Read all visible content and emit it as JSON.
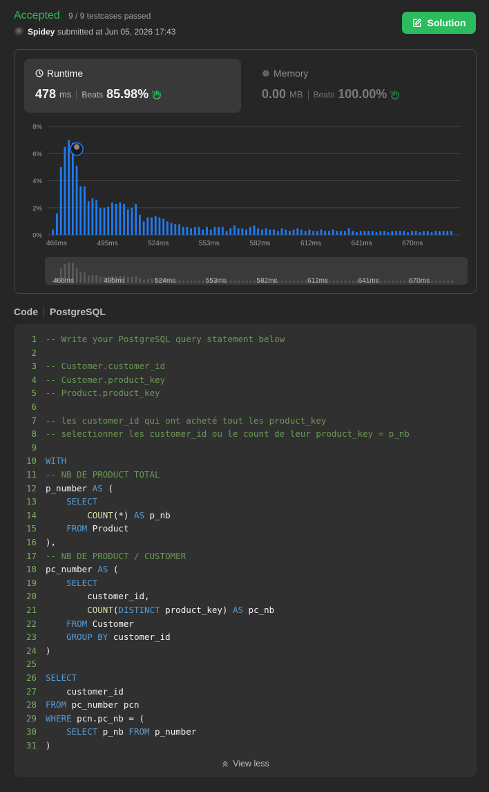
{
  "header": {
    "status": "Accepted",
    "testcases": "9 / 9 testcases passed",
    "username": "Spidey",
    "submitted": "submitted at Jun 05, 2026 17:43",
    "solution_label": "Solution"
  },
  "runtime": {
    "title": "Runtime",
    "value": "478",
    "unit": "ms",
    "beats_label": "Beats",
    "beats": "85.98%"
  },
  "memory": {
    "title": "Memory",
    "value": "0.00",
    "unit": "MB",
    "beats_label": "Beats",
    "beats": "100.00%"
  },
  "colors": {
    "accent": "#2cbb5d",
    "bar": "#1f7bf2",
    "gold_hand": "#2cbb5d"
  },
  "chart_data": {
    "type": "bar",
    "ylabel": "",
    "xlabel": "",
    "y_ticks": [
      "8%",
      "6%",
      "4%",
      "2%",
      "0%"
    ],
    "ylim": [
      0,
      8
    ],
    "x_tick_labels": [
      "466ms",
      "495ms",
      "524ms",
      "553ms",
      "582ms",
      "612ms",
      "641ms",
      "670ms"
    ],
    "xlim": [
      461,
      691
    ],
    "highlight_x": 478,
    "values": [
      {
        "x": 464,
        "y": 0.4
      },
      {
        "x": 466.2,
        "y": 1.6
      },
      {
        "x": 468.4,
        "y": 5.0
      },
      {
        "x": 470.6,
        "y": 6.5
      },
      {
        "x": 472.8,
        "y": 7.0
      },
      {
        "x": 475,
        "y": 6.8
      },
      {
        "x": 477.2,
        "y": 5.1
      },
      {
        "x": 479.4,
        "y": 3.6
      },
      {
        "x": 481.6,
        "y": 3.6
      },
      {
        "x": 483.8,
        "y": 2.5
      },
      {
        "x": 486,
        "y": 2.7
      },
      {
        "x": 488.2,
        "y": 2.6
      },
      {
        "x": 490.4,
        "y": 2.0
      },
      {
        "x": 492.6,
        "y": 2.0
      },
      {
        "x": 494.8,
        "y": 2.1
      },
      {
        "x": 497,
        "y": 2.4
      },
      {
        "x": 499.2,
        "y": 2.3
      },
      {
        "x": 501.4,
        "y": 2.4
      },
      {
        "x": 503.6,
        "y": 2.3
      },
      {
        "x": 505.8,
        "y": 1.9
      },
      {
        "x": 508,
        "y": 2.0
      },
      {
        "x": 510.2,
        "y": 2.3
      },
      {
        "x": 512.4,
        "y": 1.5
      },
      {
        "x": 514.6,
        "y": 1.0
      },
      {
        "x": 516.8,
        "y": 1.3
      },
      {
        "x": 519,
        "y": 1.3
      },
      {
        "x": 521.2,
        "y": 1.4
      },
      {
        "x": 523.4,
        "y": 1.3
      },
      {
        "x": 525.6,
        "y": 1.2
      },
      {
        "x": 527.8,
        "y": 1.0
      },
      {
        "x": 530,
        "y": 0.9
      },
      {
        "x": 532.2,
        "y": 0.8
      },
      {
        "x": 534.4,
        "y": 0.8
      },
      {
        "x": 536.6,
        "y": 0.6
      },
      {
        "x": 538.8,
        "y": 0.6
      },
      {
        "x": 541,
        "y": 0.5
      },
      {
        "x": 543.2,
        "y": 0.6
      },
      {
        "x": 545.4,
        "y": 0.6
      },
      {
        "x": 547.6,
        "y": 0.4
      },
      {
        "x": 549.8,
        "y": 0.6
      },
      {
        "x": 552,
        "y": 0.4
      },
      {
        "x": 554.2,
        "y": 0.6
      },
      {
        "x": 556.4,
        "y": 0.6
      },
      {
        "x": 558.6,
        "y": 0.6
      },
      {
        "x": 560.8,
        "y": 0.3
      },
      {
        "x": 563,
        "y": 0.5
      },
      {
        "x": 565.2,
        "y": 0.7
      },
      {
        "x": 567.4,
        "y": 0.5
      },
      {
        "x": 569.6,
        "y": 0.5
      },
      {
        "x": 571.8,
        "y": 0.4
      },
      {
        "x": 574,
        "y": 0.6
      },
      {
        "x": 576.2,
        "y": 0.7
      },
      {
        "x": 578.4,
        "y": 0.5
      },
      {
        "x": 580.6,
        "y": 0.4
      },
      {
        "x": 582.8,
        "y": 0.5
      },
      {
        "x": 585,
        "y": 0.4
      },
      {
        "x": 587.2,
        "y": 0.4
      },
      {
        "x": 589.4,
        "y": 0.3
      },
      {
        "x": 591.6,
        "y": 0.5
      },
      {
        "x": 593.8,
        "y": 0.4
      },
      {
        "x": 596,
        "y": 0.3
      },
      {
        "x": 598.2,
        "y": 0.4
      },
      {
        "x": 600.4,
        "y": 0.5
      },
      {
        "x": 602.6,
        "y": 0.4
      },
      {
        "x": 604.8,
        "y": 0.3
      },
      {
        "x": 607,
        "y": 0.4
      },
      {
        "x": 609.2,
        "y": 0.3
      },
      {
        "x": 611.4,
        "y": 0.3
      },
      {
        "x": 613.6,
        "y": 0.4
      },
      {
        "x": 615.8,
        "y": 0.3
      },
      {
        "x": 618,
        "y": 0.3
      },
      {
        "x": 620.2,
        "y": 0.4
      },
      {
        "x": 622.4,
        "y": 0.3
      },
      {
        "x": 624.6,
        "y": 0.3
      },
      {
        "x": 626.8,
        "y": 0.3
      },
      {
        "x": 629,
        "y": 0.5
      },
      {
        "x": 631.2,
        "y": 0.3
      },
      {
        "x": 633.4,
        "y": 0.2
      },
      {
        "x": 635.6,
        "y": 0.3
      },
      {
        "x": 637.8,
        "y": 0.3
      },
      {
        "x": 640,
        "y": 0.3
      },
      {
        "x": 642.2,
        "y": 0.3
      },
      {
        "x": 644.4,
        "y": 0.2
      },
      {
        "x": 646.6,
        "y": 0.3
      },
      {
        "x": 648.8,
        "y": 0.3
      },
      {
        "x": 651,
        "y": 0.2
      },
      {
        "x": 653.2,
        "y": 0.3
      },
      {
        "x": 655.4,
        "y": 0.3
      },
      {
        "x": 657.6,
        "y": 0.3
      },
      {
        "x": 659.8,
        "y": 0.3
      },
      {
        "x": 662,
        "y": 0.2
      },
      {
        "x": 664.2,
        "y": 0.3
      },
      {
        "x": 666.4,
        "y": 0.3
      },
      {
        "x": 668.6,
        "y": 0.2
      },
      {
        "x": 670.8,
        "y": 0.3
      },
      {
        "x": 673,
        "y": 0.3
      },
      {
        "x": 675.2,
        "y": 0.2
      },
      {
        "x": 677.4,
        "y": 0.3
      },
      {
        "x": 679.6,
        "y": 0.3
      },
      {
        "x": 681.8,
        "y": 0.3
      },
      {
        "x": 684,
        "y": 0.3
      },
      {
        "x": 686.2,
        "y": 0.3
      }
    ],
    "navigator_tick_labels": [
      "466ms",
      "495ms",
      "524ms",
      "553ms",
      "582ms",
      "612ms",
      "641ms",
      "670ms"
    ]
  },
  "code": {
    "tab": "Code",
    "language": "PostgreSQL",
    "view_less": "View less",
    "lines": [
      [
        {
          "t": "c",
          "s": "-- Write your PostgreSQL query statement below"
        }
      ],
      [],
      [
        {
          "t": "c",
          "s": "-- Customer.customer_id"
        }
      ],
      [
        {
          "t": "c",
          "s": "-- Customer.product_key"
        }
      ],
      [
        {
          "t": "c",
          "s": "-- Product.product_key"
        }
      ],
      [],
      [
        {
          "t": "c",
          "s": "-- les customer_id qui ont acheté tout les product_key"
        }
      ],
      [
        {
          "t": "c",
          "s": "-- selectionner les customer_id ou le count de leur product_key = p_nb"
        }
      ],
      [],
      [
        {
          "t": "k",
          "s": "WITH"
        }
      ],
      [
        {
          "t": "c",
          "s": "-- NB DE PRODUCT TOTAL"
        }
      ],
      [
        {
          "t": "p",
          "s": "p_number "
        },
        {
          "t": "k",
          "s": "AS"
        },
        {
          "t": "p",
          "s": " ("
        }
      ],
      [
        {
          "t": "p",
          "s": "    "
        },
        {
          "t": "k",
          "s": "SELECT"
        }
      ],
      [
        {
          "t": "p",
          "s": "        "
        },
        {
          "t": "f",
          "s": "COUNT"
        },
        {
          "t": "p",
          "s": "(*) "
        },
        {
          "t": "k",
          "s": "AS"
        },
        {
          "t": "p",
          "s": " p_nb"
        }
      ],
      [
        {
          "t": "p",
          "s": "    "
        },
        {
          "t": "k",
          "s": "FROM"
        },
        {
          "t": "p",
          "s": " Product"
        }
      ],
      [
        {
          "t": "p",
          "s": "),"
        }
      ],
      [
        {
          "t": "c",
          "s": "-- NB DE PRODUCT / CUSTOMER"
        }
      ],
      [
        {
          "t": "p",
          "s": "pc_number "
        },
        {
          "t": "k",
          "s": "AS"
        },
        {
          "t": "p",
          "s": " ("
        }
      ],
      [
        {
          "t": "p",
          "s": "    "
        },
        {
          "t": "k",
          "s": "SELECT"
        }
      ],
      [
        {
          "t": "p",
          "s": "        customer_id,"
        }
      ],
      [
        {
          "t": "p",
          "s": "        "
        },
        {
          "t": "f",
          "s": "COUNT"
        },
        {
          "t": "p",
          "s": "("
        },
        {
          "t": "k",
          "s": "DISTINCT"
        },
        {
          "t": "p",
          "s": " product_key) "
        },
        {
          "t": "k",
          "s": "AS"
        },
        {
          "t": "p",
          "s": " pc_nb"
        }
      ],
      [
        {
          "t": "p",
          "s": "    "
        },
        {
          "t": "k",
          "s": "FROM"
        },
        {
          "t": "p",
          "s": " Customer"
        }
      ],
      [
        {
          "t": "p",
          "s": "    "
        },
        {
          "t": "k",
          "s": "GROUP BY"
        },
        {
          "t": "p",
          "s": " customer_id"
        }
      ],
      [
        {
          "t": "p",
          "s": ")"
        }
      ],
      [],
      [
        {
          "t": "k",
          "s": "SELECT"
        }
      ],
      [
        {
          "t": "p",
          "s": "    customer_id"
        }
      ],
      [
        {
          "t": "k",
          "s": "FROM"
        },
        {
          "t": "p",
          "s": " pc_number pcn"
        }
      ],
      [
        {
          "t": "k",
          "s": "WHERE"
        },
        {
          "t": "p",
          "s": " pcn.pc_nb = ("
        }
      ],
      [
        {
          "t": "p",
          "s": "    "
        },
        {
          "t": "k",
          "s": "SELECT"
        },
        {
          "t": "p",
          "s": " p_nb "
        },
        {
          "t": "k",
          "s": "FROM"
        },
        {
          "t": "p",
          "s": " p_number"
        }
      ],
      [
        {
          "t": "p",
          "s": ")"
        }
      ]
    ]
  }
}
